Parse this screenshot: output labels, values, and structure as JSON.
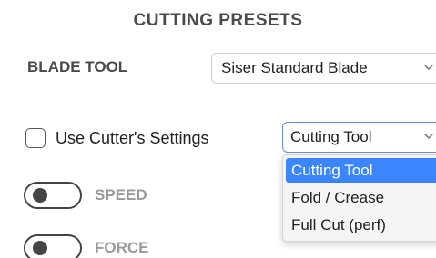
{
  "title": "CUTTING PRESETS",
  "blade": {
    "label": "BLADE TOOL",
    "selected": "Siser Standard Blade"
  },
  "use_cutter_settings": {
    "label": "Use Cutter's Settings",
    "checked": false
  },
  "tool_select": {
    "selected": "Cutting Tool",
    "options": [
      "Cutting Tool",
      "Fold / Crease",
      "Full Cut (perf)"
    ],
    "highlighted_index": 0
  },
  "toggles": [
    {
      "label": "SPEED",
      "on": false
    },
    {
      "label": "FORCE",
      "on": false
    }
  ],
  "colors": {
    "highlight": "#3b86ff",
    "focus_border": "#6b8fd6",
    "disabled_text": "#9a9a9a"
  },
  "icons": {
    "dropdown": "chevron-down-icon",
    "checkbox": "checkbox-unchecked-icon"
  }
}
